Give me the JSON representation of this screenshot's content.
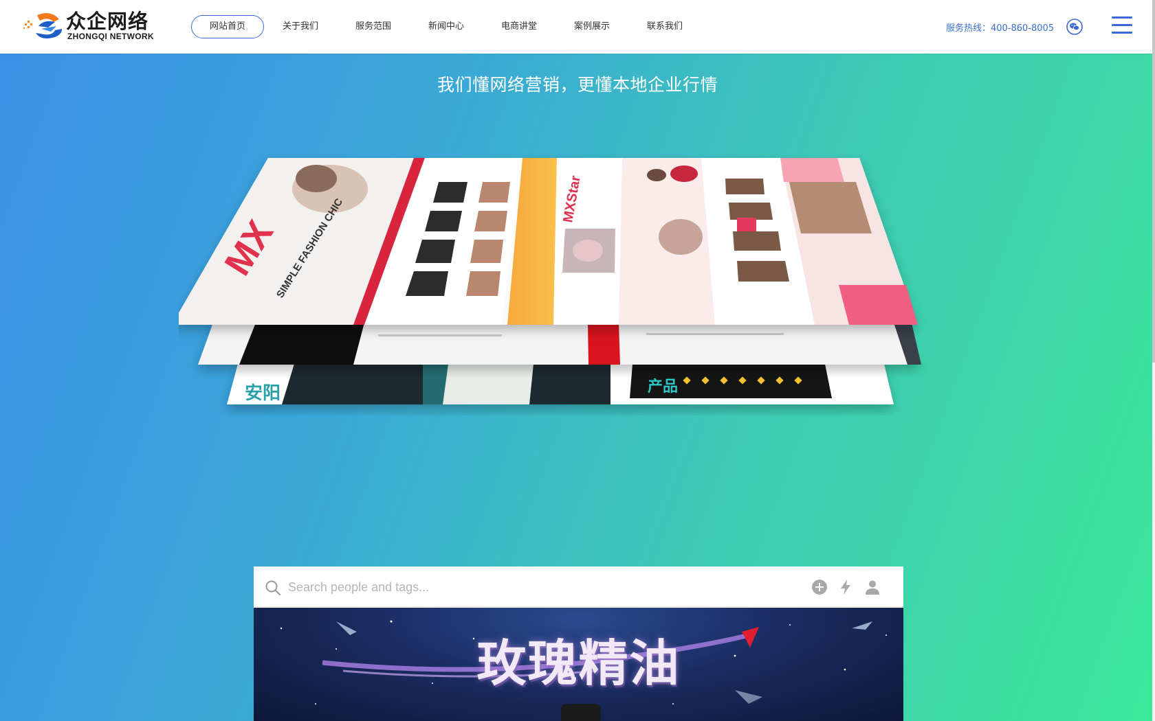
{
  "brand": {
    "name_cn": "众企网络",
    "name_en": "ZHONGQI NETWORK"
  },
  "nav": {
    "items": [
      {
        "label": "网站首页",
        "active": true
      },
      {
        "label": "关于我们"
      },
      {
        "label": "服务范围"
      },
      {
        "label": "新闻中心"
      },
      {
        "label": "电商讲堂"
      },
      {
        "label": "案例展示"
      },
      {
        "label": "联系我们"
      }
    ]
  },
  "header": {
    "hotline": "服务热线：400-860-8005",
    "wechat_icon": "wechat-icon",
    "menu_icon": "hamburger-menu-icon"
  },
  "hero": {
    "title": "我们懂网络营销，更懂本地企业行情",
    "mockup_texts": {
      "fashion_big": "MX",
      "fashion_sub": "SIMPLE FASHION CHIC",
      "star": "MXStar",
      "brand_tag": "安阳",
      "product_tag": "产品"
    }
  },
  "search": {
    "placeholder": "Search people and tags..."
  },
  "banner": {
    "title": "玫瑰精油"
  },
  "colors": {
    "accent": "#3a66d6",
    "gradient_start": "#3b8fe8",
    "gradient_end": "#3de79a"
  }
}
